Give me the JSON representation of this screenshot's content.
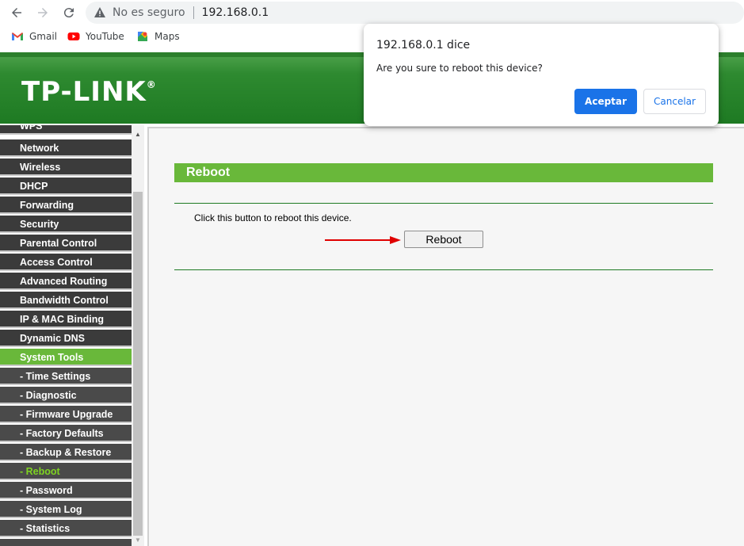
{
  "browser": {
    "security_label": "No es seguro",
    "url": "192.168.0.1"
  },
  "bookmarks": [
    {
      "label": "Gmail"
    },
    {
      "label": "YouTube"
    },
    {
      "label": "Maps"
    }
  ],
  "router": {
    "logo_text": "TP-LINK",
    "logo_mark": "®"
  },
  "sidebar": {
    "items": [
      {
        "label": "WPS"
      },
      {
        "label": "Network"
      },
      {
        "label": "Wireless"
      },
      {
        "label": "DHCP"
      },
      {
        "label": "Forwarding"
      },
      {
        "label": "Security"
      },
      {
        "label": "Parental Control"
      },
      {
        "label": "Access Control"
      },
      {
        "label": "Advanced Routing"
      },
      {
        "label": "Bandwidth Control"
      },
      {
        "label": "IP & MAC Binding"
      },
      {
        "label": "Dynamic DNS"
      },
      {
        "label": "System Tools"
      },
      {
        "label": "- Time Settings"
      },
      {
        "label": "- Diagnostic"
      },
      {
        "label": "- Firmware Upgrade"
      },
      {
        "label": "- Factory Defaults"
      },
      {
        "label": "- Backup & Restore"
      },
      {
        "label": "- Reboot"
      },
      {
        "label": "- Password"
      },
      {
        "label": "- System Log"
      },
      {
        "label": "- Statistics"
      }
    ]
  },
  "main": {
    "section_title": "Reboot",
    "description": "Click this button to reboot this device.",
    "reboot_button": "Reboot"
  },
  "dialog": {
    "title": "192.168.0.1 dice",
    "message": "Are you sure to reboot this device?",
    "ok_label": "Aceptar",
    "cancel_label": "Cancelar"
  },
  "colors": {
    "menu_active": "#69b83a",
    "menu_current_text": "#7ed321",
    "dialog_primary": "#1a73e8",
    "annotation_arrow": "#e00000"
  }
}
